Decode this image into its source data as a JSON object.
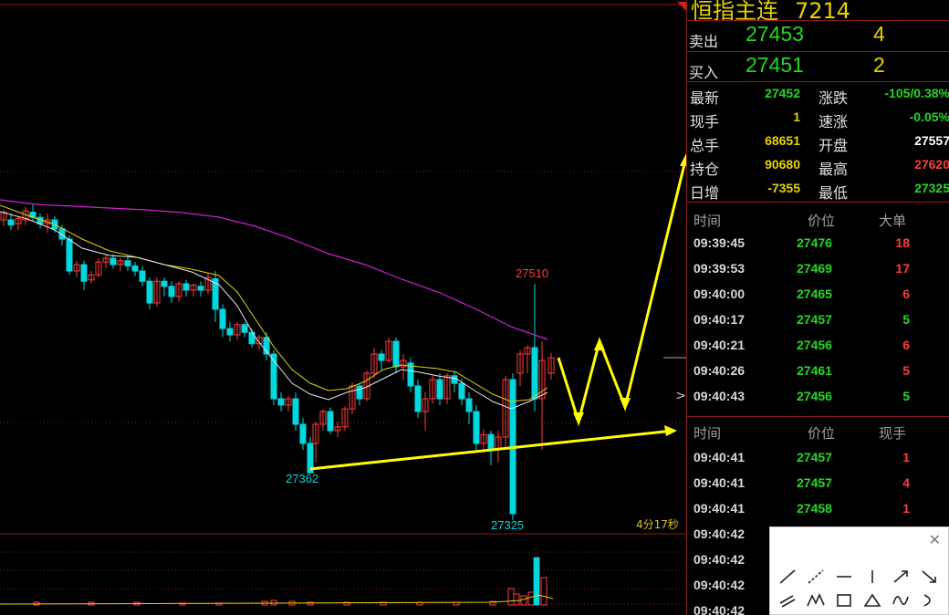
{
  "header": {
    "title": "恒指主连",
    "code": "7214"
  },
  "quote": {
    "ask": {
      "label": "卖出",
      "price": "27453",
      "qty": "4"
    },
    "bid": {
      "label": "买入",
      "price": "27451",
      "qty": "2"
    },
    "rows": [
      {
        "l1": "最新",
        "v1": "27452",
        "v1_color": "#22d822",
        "l2": "涨跌",
        "v2": "-105/0.38%",
        "v2_color": "#22d822"
      },
      {
        "l1": "现手",
        "v1": "1",
        "v1_color": "#e6d200",
        "l2": "速涨",
        "v2": "-0.05%",
        "v2_color": "#22d822"
      },
      {
        "l1": "总手",
        "v1": "68651",
        "v1_color": "#e6d200",
        "l2": "开盘",
        "v2": "27557",
        "v2_color": "#ffffff"
      },
      {
        "l1": "持仓",
        "v1": "90680",
        "v1_color": "#e6d200",
        "l2": "最高",
        "v2": "27620",
        "v2_color": "#ff3c3c"
      },
      {
        "l1": "日增",
        "v1": "-7355",
        "v1_color": "#e6d200",
        "l2": "最低",
        "v2": "27325",
        "v2_color": "#22d822"
      }
    ]
  },
  "big_orders": {
    "headers": {
      "time": "时间",
      "price": "价位",
      "vol": "大单"
    },
    "rows": [
      {
        "time": "09:39:45",
        "price": "27476",
        "vol": "18",
        "vol_color": "red"
      },
      {
        "time": "09:39:53",
        "price": "27469",
        "vol": "17",
        "vol_color": "red"
      },
      {
        "time": "09:40:00",
        "price": "27465",
        "vol": "6",
        "vol_color": "red"
      },
      {
        "time": "09:40:17",
        "price": "27457",
        "vol": "5",
        "vol_color": "green"
      },
      {
        "time": "09:40:21",
        "price": "27456",
        "vol": "6",
        "vol_color": "red"
      },
      {
        "time": "09:40:26",
        "price": "27461",
        "vol": "5",
        "vol_color": "red"
      },
      {
        "time": "09:40:43",
        "price": "27456",
        "vol": "5",
        "vol_color": "green"
      }
    ]
  },
  "ticks": {
    "headers": {
      "time": "时间",
      "price": "价位",
      "vol": "现手"
    },
    "rows": [
      {
        "time": "09:40:41",
        "price": "27457",
        "vol": "1",
        "vol_color": "red"
      },
      {
        "time": "09:40:41",
        "price": "27457",
        "vol": "4",
        "vol_color": "red"
      },
      {
        "time": "09:40:41",
        "price": "27458",
        "vol": "1",
        "vol_color": "red"
      },
      {
        "time": "09:40:42",
        "price": "",
        "vol": "",
        "vol_color": "red"
      },
      {
        "time": "09:40:42",
        "price": "",
        "vol": "",
        "vol_color": "red"
      },
      {
        "time": "09:40:42",
        "price": "",
        "vol": "",
        "vol_color": "red"
      },
      {
        "time": "09:40:42",
        "price": "",
        "vol": "",
        "vol_color": "red"
      }
    ]
  },
  "chart": {
    "countdown": "4分17秒",
    "annotations": {
      "high": "27510",
      "low_left": "27362",
      "low_right": "27325"
    }
  },
  "drawing_tools": {
    "close_icon": "close-icon",
    "tools": [
      "line-tool-icon",
      "ray-tool-icon",
      "horizontal-line-icon",
      "vertical-line-icon",
      "arrow-up-right-icon",
      "arrow-down-right-icon",
      "parallel-lines-icon",
      "wave-icon",
      "rectangle-icon",
      "triangle-icon",
      "sine-icon",
      "arc-icon"
    ]
  },
  "colors": {
    "up": "#ff3c3c",
    "down": "#00d8e0",
    "ma_long": "#d020d0",
    "ma_mid": "#e6d200",
    "ma_short": "#e8e8e8",
    "annotation_arrow": "#ffff00",
    "grid": "#8a1a1a"
  }
}
